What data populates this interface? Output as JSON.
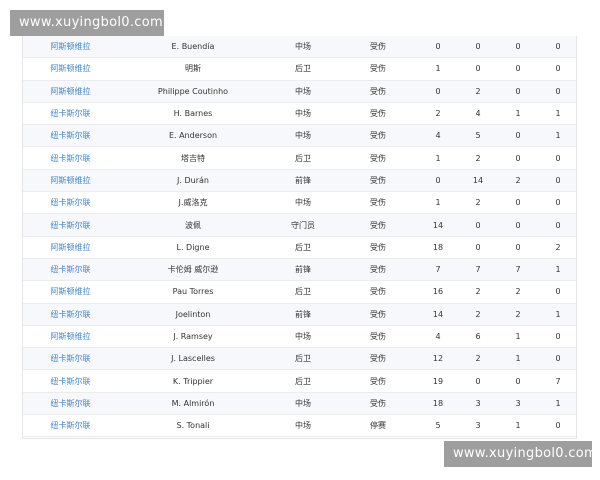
{
  "watermarks": {
    "top": "www.xuyingbol0.com",
    "bottom": "www.xuyingbol0.com"
  },
  "rows": [
    {
      "team": "阿斯顿维拉",
      "player": "E. Buendía",
      "position": "中场",
      "status": "受伤",
      "v1": "0",
      "v2": "0",
      "v3": "0",
      "v4": "0"
    },
    {
      "team": "阿斯顿维拉",
      "player": "明斯",
      "position": "后卫",
      "status": "受伤",
      "v1": "1",
      "v2": "0",
      "v3": "0",
      "v4": "0"
    },
    {
      "team": "阿斯顿维拉",
      "player": "Philippe Coutinho",
      "position": "中场",
      "status": "受伤",
      "v1": "0",
      "v2": "2",
      "v3": "0",
      "v4": "0"
    },
    {
      "team": "纽卡斯尔联",
      "player": "H. Barnes",
      "position": "中场",
      "status": "受伤",
      "v1": "2",
      "v2": "4",
      "v3": "1",
      "v4": "1"
    },
    {
      "team": "纽卡斯尔联",
      "player": "E. Anderson",
      "position": "中场",
      "status": "受伤",
      "v1": "4",
      "v2": "5",
      "v3": "0",
      "v4": "1"
    },
    {
      "team": "纽卡斯尔联",
      "player": "塔吉特",
      "position": "后卫",
      "status": "受伤",
      "v1": "1",
      "v2": "2",
      "v3": "0",
      "v4": "0"
    },
    {
      "team": "阿斯顿维拉",
      "player": "J. Durán",
      "position": "前锋",
      "status": "受伤",
      "v1": "0",
      "v2": "14",
      "v3": "2",
      "v4": "0"
    },
    {
      "team": "纽卡斯尔联",
      "player": "J.威洛克",
      "position": "中场",
      "status": "受伤",
      "v1": "1",
      "v2": "2",
      "v3": "0",
      "v4": "0"
    },
    {
      "team": "纽卡斯尔联",
      "player": "波佩",
      "position": "守门员",
      "status": "受伤",
      "v1": "14",
      "v2": "0",
      "v3": "0",
      "v4": "0"
    },
    {
      "team": "阿斯顿维拉",
      "player": "L. Digne",
      "position": "后卫",
      "status": "受伤",
      "v1": "18",
      "v2": "0",
      "v3": "0",
      "v4": "2"
    },
    {
      "team": "纽卡斯尔联",
      "player": "卡伦姆 威尔逊",
      "position": "前锋",
      "status": "受伤",
      "v1": "7",
      "v2": "7",
      "v3": "7",
      "v4": "1"
    },
    {
      "team": "阿斯顿维拉",
      "player": "Pau Torres",
      "position": "后卫",
      "status": "受伤",
      "v1": "16",
      "v2": "2",
      "v3": "2",
      "v4": "0"
    },
    {
      "team": "纽卡斯尔联",
      "player": "Joelinton",
      "position": "前锋",
      "status": "受伤",
      "v1": "14",
      "v2": "2",
      "v3": "2",
      "v4": "1"
    },
    {
      "team": "阿斯顿维拉",
      "player": "J. Ramsey",
      "position": "中场",
      "status": "受伤",
      "v1": "4",
      "v2": "6",
      "v3": "1",
      "v4": "0"
    },
    {
      "team": "纽卡斯尔联",
      "player": "J. Lascelles",
      "position": "后卫",
      "status": "受伤",
      "v1": "12",
      "v2": "2",
      "v3": "1",
      "v4": "0"
    },
    {
      "team": "纽卡斯尔联",
      "player": "K. Trippier",
      "position": "后卫",
      "status": "受伤",
      "v1": "19",
      "v2": "0",
      "v3": "0",
      "v4": "7"
    },
    {
      "team": "纽卡斯尔联",
      "player": "M. Almirón",
      "position": "中场",
      "status": "受伤",
      "v1": "18",
      "v2": "3",
      "v3": "3",
      "v4": "1"
    },
    {
      "team": "纽卡斯尔联",
      "player": "S. Tonali",
      "position": "中场",
      "status": "停赛",
      "v1": "5",
      "v2": "3",
      "v3": "1",
      "v4": "0"
    }
  ]
}
